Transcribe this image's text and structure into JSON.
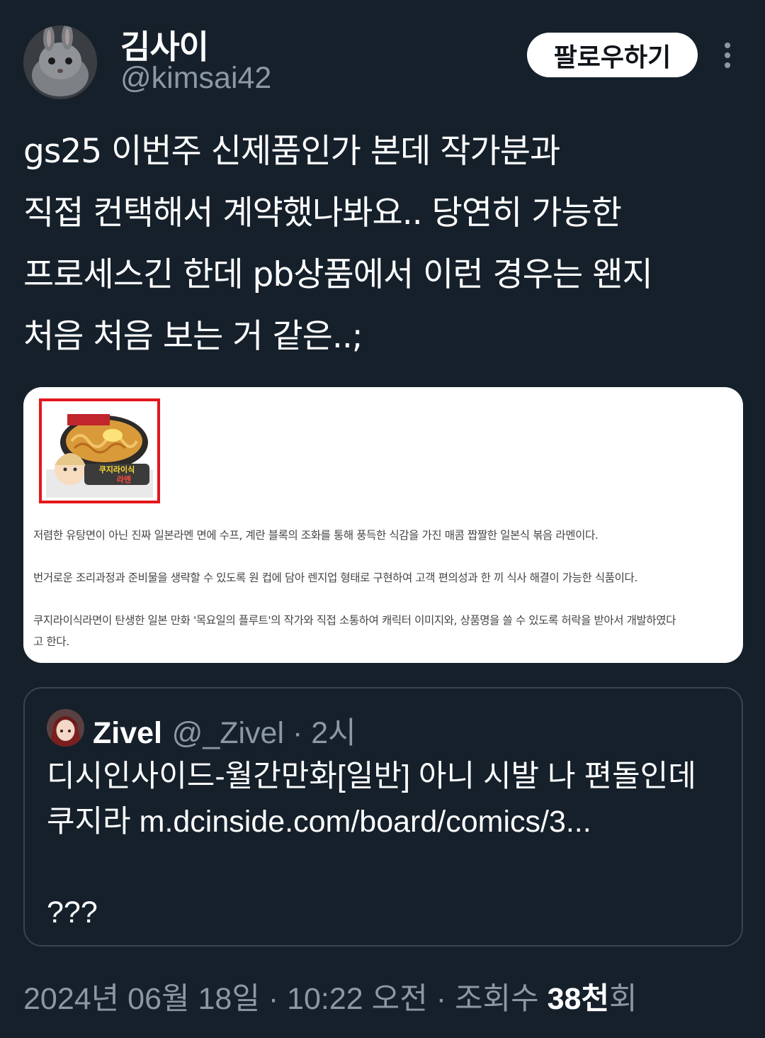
{
  "author": {
    "display_name": "김사이",
    "handle": "@kimsai42",
    "avatar_icon": "rabbit-avatar"
  },
  "follow_label": "팔로우하기",
  "more_icon": "more-vertical-icon",
  "tweet": {
    "text": "gs25 이번주 신제품인가 본데 작가분과\n직접 컨택해서 계약했나봐요.. 당연히 가능한\n프로세스긴 한데 pb상품에서 이런 경우는 왠지\n처음 처음 보는 거 같은..;"
  },
  "media": {
    "product_label_1": "쿠지라이식",
    "product_label_2": "라멘",
    "lines": [
      "저렴한 유탕면이 아닌 진짜 일본라멘 면에 수프, 계란 블록의 조화를 통해 풍득한 식감을 가진 매콤 짭짤한 일본식 볶음 라멘이다.",
      "번거로운 조리과정과 준비물을 생략할 수 있도록 원 컵에 담아 렌지업 형태로 구현하여 고객 편의성과 한 끼 식사 해결이 가능한 식품이다.",
      "쿠지라이식라면이 탄생한 일본 만화 '목요일의 플루트'의 작가와 직접 소통하여 캐릭터 이미지와, 상품명을 쓸 수 있도록 허락을 받아서 개발하였다",
      "고 한다."
    ]
  },
  "quote": {
    "name": "Zivel",
    "handle": "@_Zivel",
    "sep": " · ",
    "time": "2시",
    "text": "디시인사이드-월간만화[일반] 아니 시발 나 편돌인데\n쿠지라 m.dcinside.com/board/comics/3...\n\n???"
  },
  "footer": {
    "datetime": "2024년 06월 18일 · 10:22 오전 · 조회수 ",
    "views": "38천",
    "suffix": "회"
  },
  "colors": {
    "background": "#15202b",
    "secondary_text": "#8b98a5",
    "border": "#38444d",
    "highlight_red": "#e4161b"
  }
}
